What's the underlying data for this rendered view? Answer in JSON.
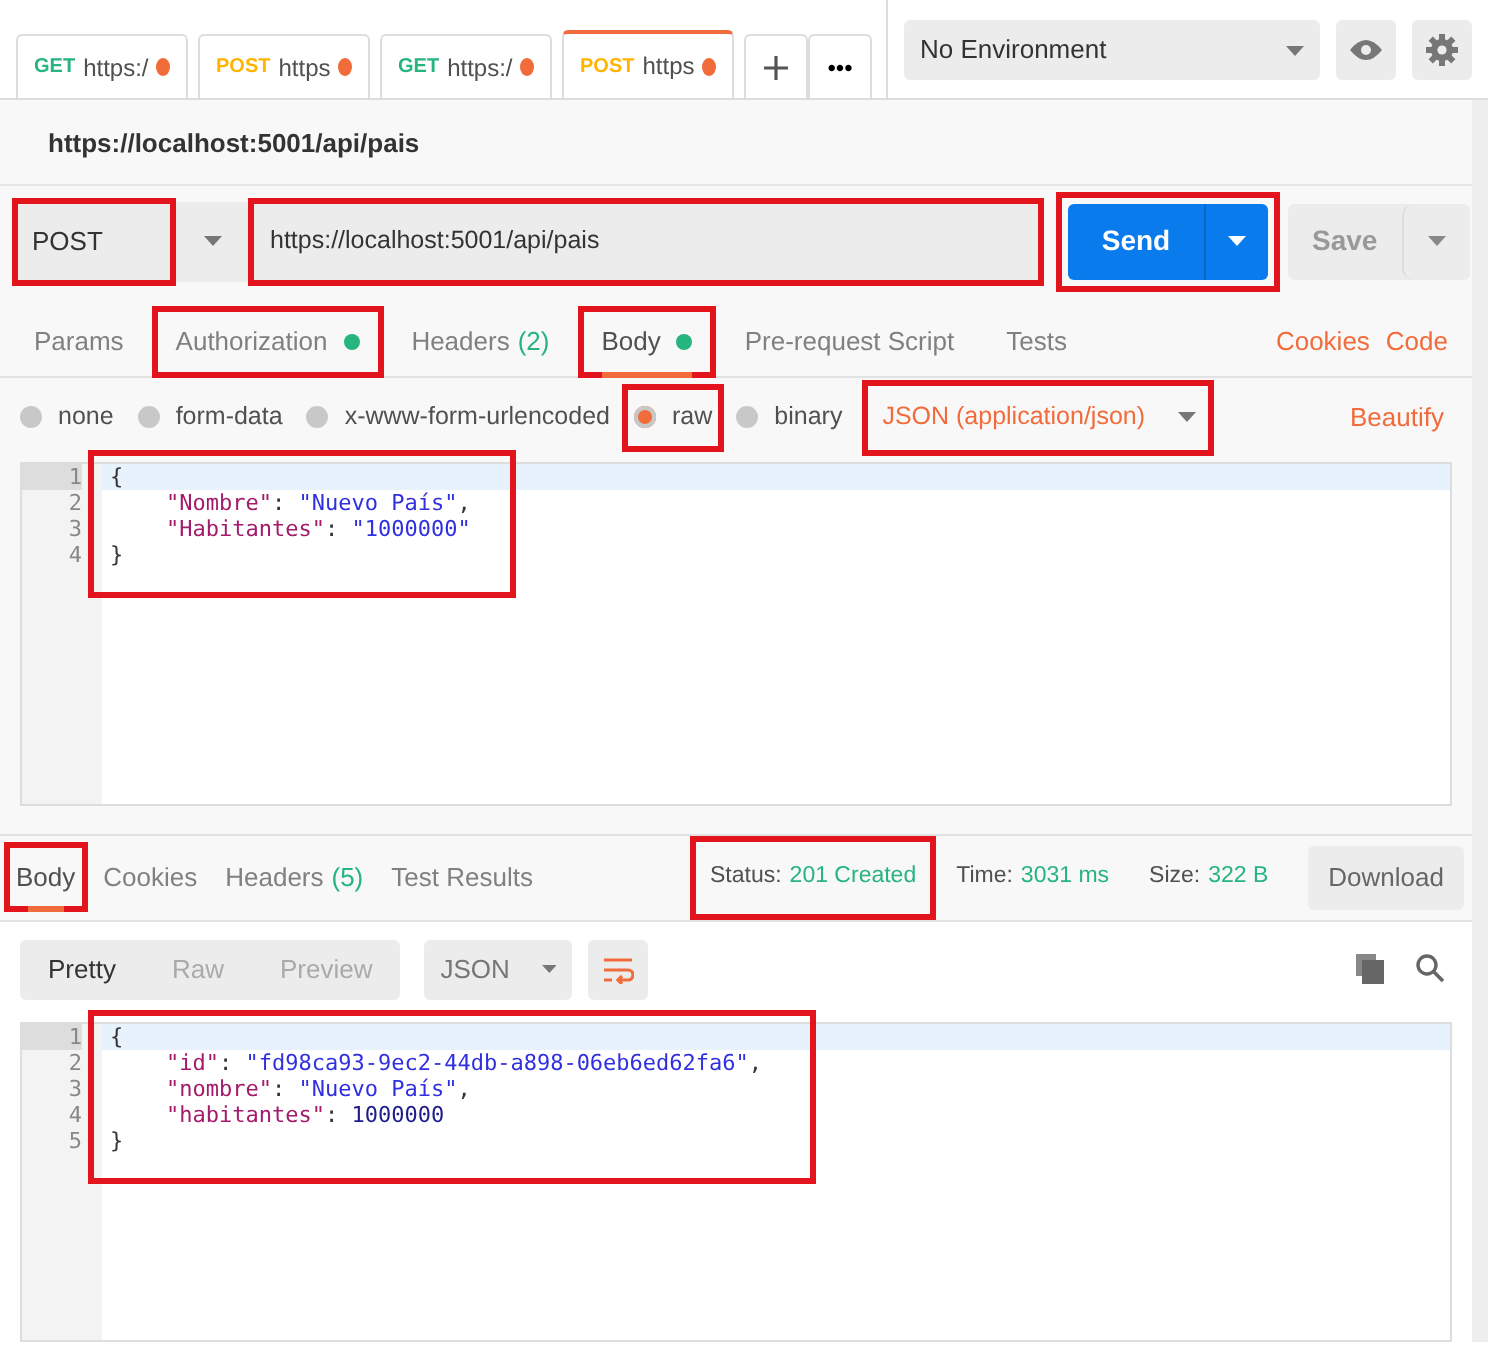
{
  "request_tabs": [
    {
      "method": "GET",
      "label": "https:/",
      "selected": false
    },
    {
      "method": "POST",
      "label": "https",
      "selected": false
    },
    {
      "method": "GET",
      "label": "https:/",
      "selected": false
    },
    {
      "method": "POST",
      "label": "https",
      "selected": true
    }
  ],
  "more_tabs": "•••",
  "environment": {
    "value": "No Environment"
  },
  "request_title": "https://localhost:5001/api/pais",
  "method": {
    "value": "POST",
    "highlighted": true
  },
  "url": {
    "value": "https://localhost:5001/api/pais",
    "highlighted": true
  },
  "send": {
    "label": "Send",
    "highlighted": true
  },
  "save": {
    "label": "Save"
  },
  "section_tabs": [
    {
      "label": "Params",
      "dot": false,
      "selected": false,
      "highlighted": false
    },
    {
      "label": "Authorization",
      "dot": true,
      "selected": false,
      "highlighted": true
    },
    {
      "label": "Headers",
      "count": "(2)",
      "dot": false,
      "selected": false,
      "highlighted": false
    },
    {
      "label": "Body",
      "dot": true,
      "selected": true,
      "highlighted": true
    },
    {
      "label": "Pre-request Script",
      "dot": false,
      "selected": false,
      "highlighted": false
    },
    {
      "label": "Tests",
      "dot": false,
      "selected": false,
      "highlighted": false
    }
  ],
  "section_links": [
    "Cookies",
    "Code"
  ],
  "body_types": [
    {
      "label": "none",
      "selected": false,
      "highlighted": false
    },
    {
      "label": "form-data",
      "selected": false,
      "highlighted": false
    },
    {
      "label": "x-www-form-urlencoded",
      "selected": false,
      "highlighted": false
    },
    {
      "label": "raw",
      "selected": true,
      "highlighted": true
    },
    {
      "label": "binary",
      "selected": false,
      "highlighted": false
    }
  ],
  "body_format": {
    "value": "JSON (application/json)",
    "highlighted": true
  },
  "beautify": "Beautify",
  "request_body": {
    "highlighted": true,
    "lines": [
      {
        "number": "1",
        "indented": false,
        "tokens": [
          {
            "kind": "punct",
            "text": "{"
          }
        ]
      },
      {
        "number": "2",
        "indented": true,
        "tokens": [
          {
            "kind": "key",
            "text": "\"Nombre\""
          },
          {
            "kind": "punct",
            "text": ": "
          },
          {
            "kind": "string",
            "text": "\"Nuevo País\""
          },
          {
            "kind": "punct",
            "text": ","
          }
        ]
      },
      {
        "number": "3",
        "indented": true,
        "tokens": [
          {
            "kind": "key",
            "text": "\"Habitantes\""
          },
          {
            "kind": "punct",
            "text": ": "
          },
          {
            "kind": "string",
            "text": "\"1000000\""
          }
        ]
      },
      {
        "number": "4",
        "indented": false,
        "tokens": [
          {
            "kind": "punct",
            "text": "}"
          }
        ]
      }
    ]
  },
  "response_tabs": [
    {
      "label": "Body",
      "selected": true,
      "highlighted": true
    },
    {
      "label": "Cookies",
      "selected": false,
      "highlighted": false
    },
    {
      "label": "Headers",
      "count": "(5)",
      "selected": false,
      "highlighted": false
    },
    {
      "label": "Test Results",
      "selected": false,
      "highlighted": false
    }
  ],
  "response_meta": [
    {
      "label": "Status:",
      "value": "201 Created",
      "highlighted": true
    },
    {
      "label": "Time:",
      "value": "3031 ms",
      "highlighted": false
    },
    {
      "label": "Size:",
      "value": "322 B",
      "highlighted": false
    }
  ],
  "download": "Download",
  "view_modes": [
    {
      "label": "Pretty",
      "selected": true
    },
    {
      "label": "Raw",
      "selected": false
    },
    {
      "label": "Preview",
      "selected": false
    }
  ],
  "response_format": "JSON",
  "response_body": {
    "highlighted": true,
    "lines": [
      {
        "number": "1",
        "indented": false,
        "tokens": [
          {
            "kind": "punct",
            "text": "{"
          }
        ]
      },
      {
        "number": "2",
        "indented": true,
        "tokens": [
          {
            "kind": "key",
            "text": "\"id\""
          },
          {
            "kind": "punct",
            "text": ": "
          },
          {
            "kind": "string",
            "text": "\"fd98ca93-9ec2-44db-a898-06eb6ed62fa6\""
          },
          {
            "kind": "punct",
            "text": ","
          }
        ]
      },
      {
        "number": "3",
        "indented": true,
        "tokens": [
          {
            "kind": "key",
            "text": "\"nombre\""
          },
          {
            "kind": "punct",
            "text": ": "
          },
          {
            "kind": "string",
            "text": "\"Nuevo País\""
          },
          {
            "kind": "punct",
            "text": ","
          }
        ]
      },
      {
        "number": "4",
        "indented": true,
        "tokens": [
          {
            "kind": "key",
            "text": "\"habitantes\""
          },
          {
            "kind": "punct",
            "text": ": "
          },
          {
            "kind": "number",
            "text": "1000000"
          }
        ]
      },
      {
        "number": "5",
        "indented": false,
        "tokens": [
          {
            "kind": "punct",
            "text": "}"
          }
        ]
      }
    ]
  }
}
